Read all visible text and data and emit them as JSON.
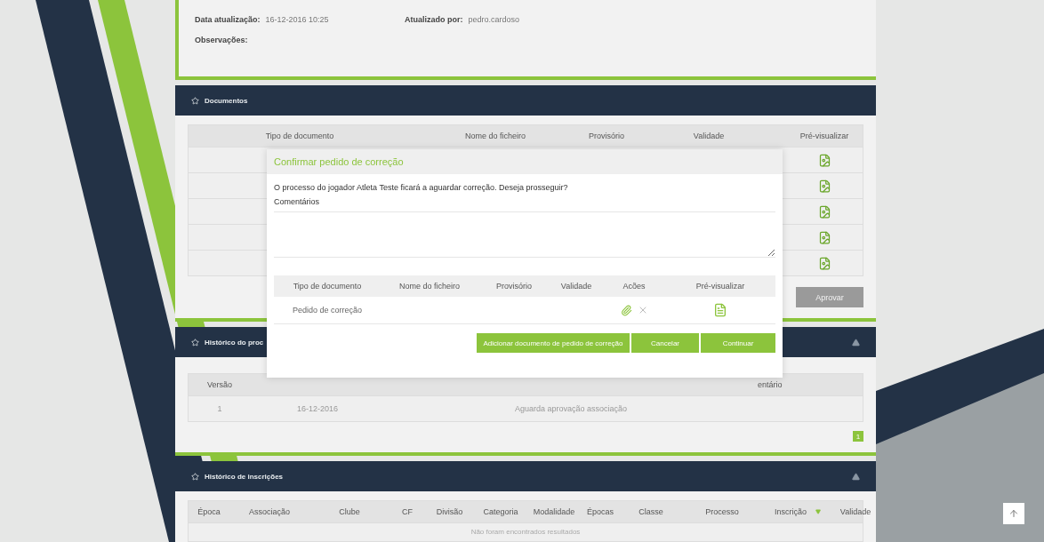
{
  "details": [
    {
      "label": "Data atualização:",
      "value": "16-12-2016 10:25"
    },
    {
      "label": "Atualizado por:",
      "value": "pedro.cardoso"
    },
    {
      "label": "Observações:"
    }
  ],
  "documents": {
    "title": "Documentos",
    "columns": [
      "Tipo de documento",
      "Nome do ficheiro",
      "Provisório",
      "Validade",
      "Pré-visualizar"
    ],
    "rows": [
      {
        "kind": "document"
      },
      {
        "kind": "document"
      },
      {
        "kind": "document"
      },
      {
        "kind": "document"
      },
      {
        "kind": "document"
      }
    ],
    "approve_button": {
      "label": "Aprovar",
      "disabled": true
    }
  },
  "process_history": {
    "title": "Histórico do proc",
    "columns": [
      "Versão",
      "",
      "",
      "entário"
    ],
    "rows": [
      [
        "1",
        "16-12-2016",
        "Aguarda aprovação associação"
      ]
    ],
    "pagination": [
      {
        "label": "1",
        "selected": true
      }
    ]
  },
  "registrations": {
    "title": "Histórico de inscrições",
    "columns": [
      {
        "label": "Época",
        "sorted": false
      },
      {
        "label": "Associação",
        "sorted": false
      },
      {
        "label": "Clube",
        "sorted": false
      },
      {
        "label": "CF",
        "sorted": false
      },
      {
        "label": "Divisão",
        "sorted": false
      },
      {
        "label": "Categoria",
        "sorted": false
      },
      {
        "label": "Modalidade",
        "sorted": false
      },
      {
        "label": "Épocas",
        "sorted": false
      },
      {
        "label": "Classe",
        "sorted": false
      },
      {
        "label": "Processo",
        "sorted": false
      },
      {
        "label": "Inscrição",
        "sorted": true
      },
      {
        "label": "Validade",
        "sorted": false
      }
    ],
    "empty": "Não foram encontrados resultados"
  },
  "dialog": {
    "title": "Confirmar pedido de correção",
    "message": "O processo do jogador Atleta Teste ficará a aguardar correção. Deseja prosseguir?",
    "comments_label": "Comentários",
    "columns": [
      "Tipo de documento",
      "Nome do ficheiro",
      "Provisório",
      "Validade",
      "Acões",
      "Pré-visualizar"
    ],
    "rows": [
      {
        "type": "Pedido de correção"
      }
    ],
    "buttons": [
      "Adicionar documento de pedido de correção",
      "Cancelar",
      "Continuar"
    ]
  }
}
